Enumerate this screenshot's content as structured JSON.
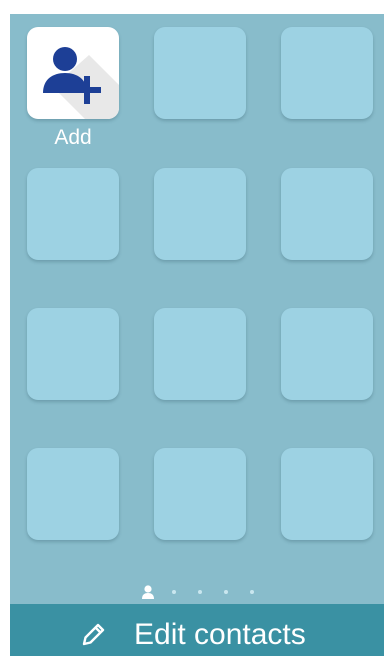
{
  "widget": {
    "add_tile": {
      "label": "Add",
      "icon": "add-contact-icon"
    },
    "empty_slots": 11
  },
  "pager": {
    "pages": 5,
    "current_page": 1,
    "current_indicator_icon": "person-icon"
  },
  "bottom_bar": {
    "label": "Edit contacts",
    "icon": "pencil-icon"
  },
  "colors": {
    "widget_background": "#88bccb",
    "tile_background": "#9dd2e3",
    "add_icon": "#1d3f96",
    "bottom_bar": "#3a91a3",
    "text": "#ffffff"
  }
}
